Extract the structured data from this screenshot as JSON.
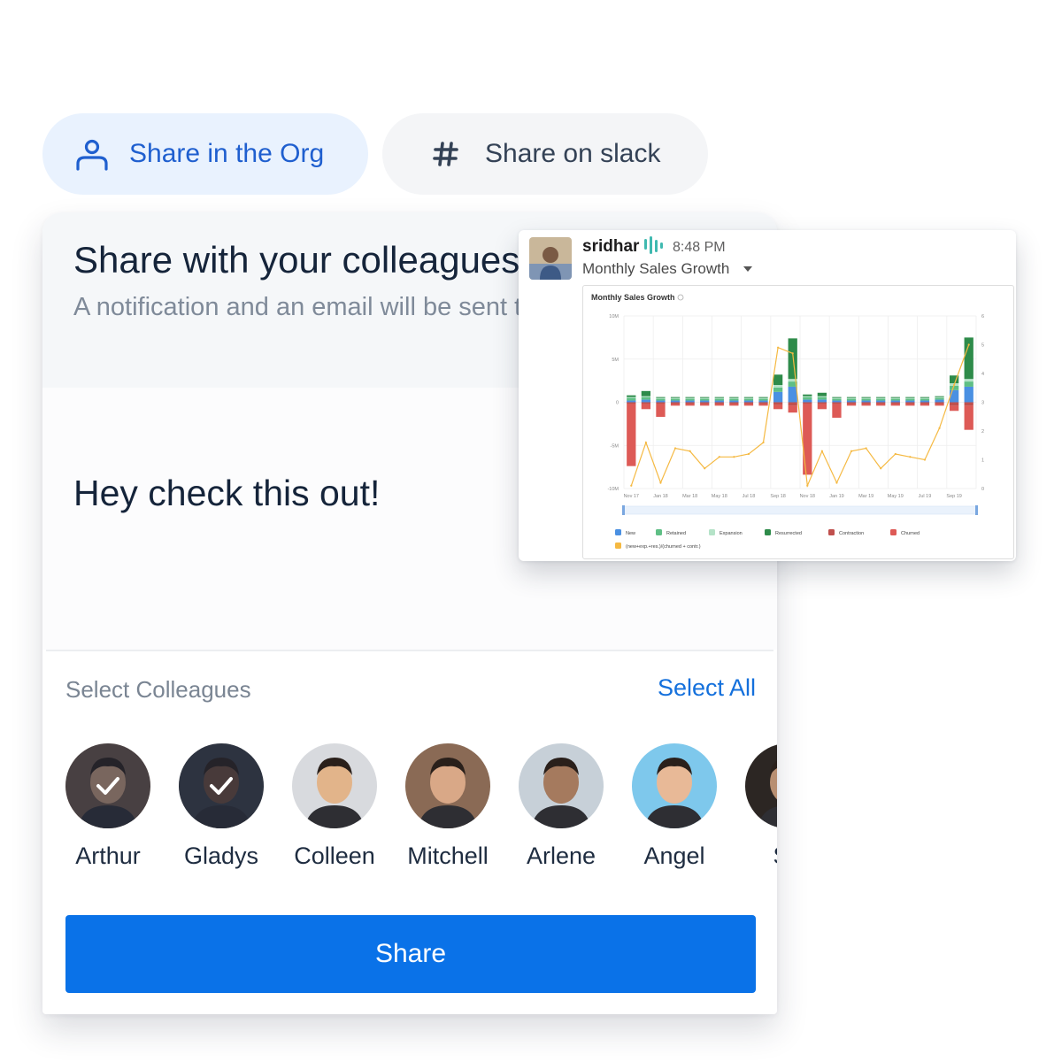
{
  "tabs": {
    "org_label": "Share in the Org",
    "slack_label": "Share on slack"
  },
  "card": {
    "title": "Share with your colleagues",
    "subtitle": "A notification and an email will be sent to your colleagues",
    "message": "Hey check this out!",
    "select_label": "Select Colleagues",
    "select_all": "Select All",
    "share_button": "Share"
  },
  "colleagues": [
    {
      "name": "Arthur",
      "selected": true,
      "bg": "#6b5548"
    },
    {
      "name": "Gladys",
      "selected": true,
      "bg": "#3a3d44"
    },
    {
      "name": "Colleen",
      "selected": false,
      "bg": "#d8dade"
    },
    {
      "name": "Mitchell",
      "selected": false,
      "bg": "#8a6a55"
    },
    {
      "name": "Arlene",
      "selected": false,
      "bg": "#c7d0d8"
    },
    {
      "name": "Angel",
      "selected": false,
      "bg": "#7ec8ec"
    },
    {
      "name": "Sh",
      "selected": false,
      "bg": "#2c2623"
    }
  ],
  "slack": {
    "user": "sridhar",
    "time": "8:48 PM",
    "title": "Monthly Sales Growth",
    "chart": {
      "title": "Monthly Sales Growth",
      "y_left_ticks": [
        "10M",
        "5M",
        "0",
        "-5M",
        "-10M"
      ],
      "y_right_ticks": [
        "6",
        "5",
        "4",
        "3",
        "2",
        "1",
        "0"
      ],
      "x_ticks": [
        "Nov 17",
        "Jan 18",
        "Mar 18",
        "May 18",
        "Jul 18",
        "Sep 18",
        "Nov 18",
        "Jan 19",
        "Mar 19",
        "May 19",
        "Jul 19",
        "Sep 19"
      ],
      "legend": [
        "New",
        "Retained",
        "Expansion",
        "Resurrected",
        "Contraction",
        "Churned",
        "(new+exp.+res.)/(churned + contr.)"
      ]
    }
  },
  "chart_data": {
    "type": "bar",
    "title": "Monthly Sales Growth",
    "categories": [
      "Nov 17",
      "Dec 17",
      "Jan 18",
      "Feb 18",
      "Mar 18",
      "Apr 18",
      "May 18",
      "Jun 18",
      "Jul 18",
      "Aug 18",
      "Sep 18",
      "Oct 18",
      "Nov 18",
      "Dec 18",
      "Jan 19",
      "Feb 19",
      "Mar 19",
      "Apr 19",
      "May 19",
      "Jun 19",
      "Jul 19",
      "Aug 19",
      "Sep 19",
      "Oct 19"
    ],
    "ylim": [
      -10,
      10
    ],
    "y2lim": [
      0,
      6
    ],
    "series": [
      {
        "name": "New",
        "color": "#4a90e2",
        "values": [
          0.2,
          0.3,
          0.2,
          0.2,
          0.2,
          0.2,
          0.2,
          0.2,
          0.2,
          0.2,
          1.2,
          1.8,
          0.3,
          0.3,
          0.2,
          0.2,
          0.2,
          0.2,
          0.2,
          0.2,
          0.2,
          0.3,
          1.4,
          1.8
        ]
      },
      {
        "name": "Retained",
        "color": "#5fbf85",
        "values": [
          0.3,
          0.3,
          0.2,
          0.2,
          0.2,
          0.2,
          0.2,
          0.2,
          0.2,
          0.2,
          0.5,
          0.6,
          0.3,
          0.3,
          0.2,
          0.2,
          0.2,
          0.2,
          0.2,
          0.2,
          0.2,
          0.2,
          0.5,
          0.6
        ]
      },
      {
        "name": "Expansion",
        "color": "#b5e3c8",
        "values": [
          0.1,
          0.1,
          0.1,
          0.1,
          0.1,
          0.1,
          0.1,
          0.1,
          0.1,
          0.1,
          0.3,
          0.3,
          0.1,
          0.1,
          0.1,
          0.1,
          0.1,
          0.1,
          0.1,
          0.1,
          0.1,
          0.1,
          0.3,
          0.3
        ]
      },
      {
        "name": "Resurrected",
        "color": "#2e8b4a",
        "values": [
          0.2,
          0.6,
          0.1,
          0.1,
          0.1,
          0.1,
          0.1,
          0.1,
          0.1,
          0.1,
          1.2,
          4.7,
          0.2,
          0.4,
          0.1,
          0.1,
          0.1,
          0.1,
          0.1,
          0.1,
          0.1,
          0.1,
          0.9,
          4.8
        ]
      },
      {
        "name": "Contraction",
        "color": "#c0504d",
        "values": [
          -0.2,
          -0.2,
          -0.2,
          -0.2,
          -0.2,
          -0.2,
          -0.2,
          -0.2,
          -0.2,
          -0.2,
          -0.3,
          -0.4,
          -0.2,
          -0.2,
          -0.2,
          -0.2,
          -0.2,
          -0.2,
          -0.2,
          -0.2,
          -0.2,
          -0.2,
          -0.4,
          -0.4
        ]
      },
      {
        "name": "Churned",
        "color": "#dd5a56",
        "values": [
          -7.2,
          -0.6,
          -1.5,
          -0.2,
          -0.2,
          -0.2,
          -0.2,
          -0.2,
          -0.2,
          -0.2,
          -0.5,
          -0.8,
          -8.2,
          -0.6,
          -1.6,
          -0.2,
          -0.2,
          -0.2,
          -0.2,
          -0.2,
          -0.2,
          -0.2,
          -0.6,
          -2.8
        ]
      }
    ],
    "ratio_series": {
      "name": "(new+exp.+res.)/(churned + contr.)",
      "color": "#f5b942",
      "values": [
        0.1,
        1.6,
        0.2,
        1.4,
        1.3,
        0.7,
        1.1,
        1.1,
        1.2,
        1.6,
        4.9,
        4.7,
        0.1,
        1.3,
        0.2,
        1.3,
        1.4,
        0.7,
        1.2,
        1.1,
        1.0,
        2.1,
        3.6,
        5.0
      ]
    }
  },
  "colors": {
    "primary": "#0a72e8",
    "tab_active_bg": "#e9f2fe",
    "tab_active_text": "#1f5fcf",
    "text_dark": "#15243a",
    "text_muted": "#7f8a99"
  }
}
